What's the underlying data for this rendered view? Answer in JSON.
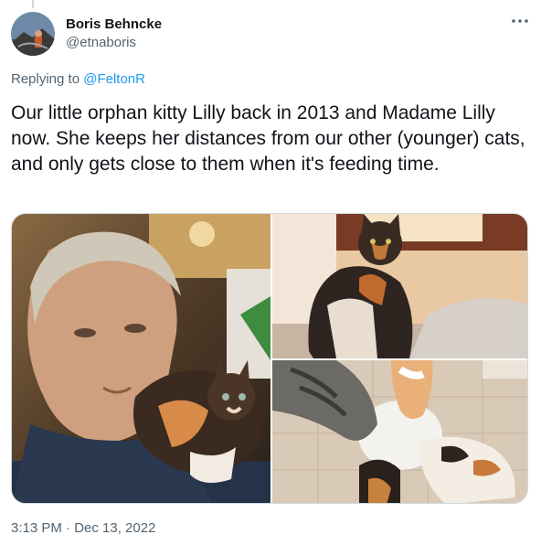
{
  "author": {
    "name": "Boris Behncke",
    "handle": "@etnaboris",
    "avatar_icon": "avatar-photo-icon"
  },
  "more_icon": "more-options-icon",
  "reply": {
    "prefix": "Replying to ",
    "mention": "@FeltonR"
  },
  "tweet": {
    "text": "Our little orphan kitty Lilly back in 2013 and Madame Lilly now. She keeps her distances from our other (younger) cats, and only gets close to them when it's feeding time."
  },
  "photos": [
    {
      "icon": "photo-man-with-kitten"
    },
    {
      "icon": "photo-calico-cat-on-couch"
    },
    {
      "icon": "photo-cats-feeding"
    }
  ],
  "timestamp": "3:13 PM · Dec 13, 2022",
  "colors": {
    "link": "#1d9bf0",
    "secondary_text": "#536471",
    "primary_text": "#0f1419",
    "border": "#cfd9de"
  }
}
